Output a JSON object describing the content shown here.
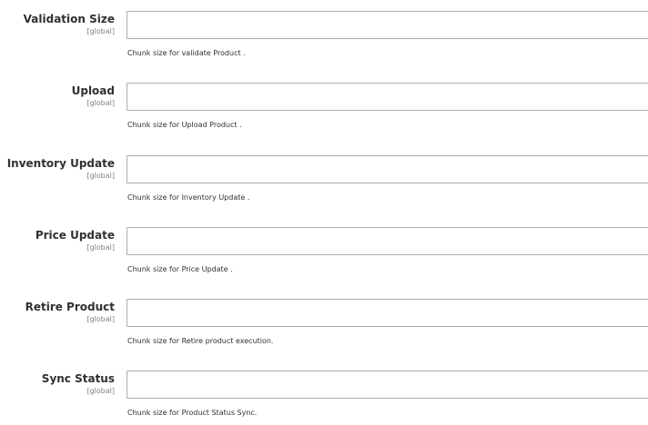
{
  "fields": [
    {
      "label": "Validation Size",
      "scope": "[global]",
      "value": "",
      "comment": "Chunk size for validate Product ."
    },
    {
      "label": "Upload",
      "scope": "[global]",
      "value": "",
      "comment": "Chunk size for Upload Product ."
    },
    {
      "label": "Inventory Update",
      "scope": "[global]",
      "value": "",
      "comment": "Chunk size for Inventory Update ."
    },
    {
      "label": "Price Update",
      "scope": "[global]",
      "value": "",
      "comment": "Chunk size for Price Update ."
    },
    {
      "label": "Retire Product",
      "scope": "[global]",
      "value": "",
      "comment": "Chunk size for Retire product execution."
    },
    {
      "label": "Sync Status",
      "scope": "[global]",
      "value": "",
      "comment": "Chunk size for Product Status Sync."
    }
  ]
}
